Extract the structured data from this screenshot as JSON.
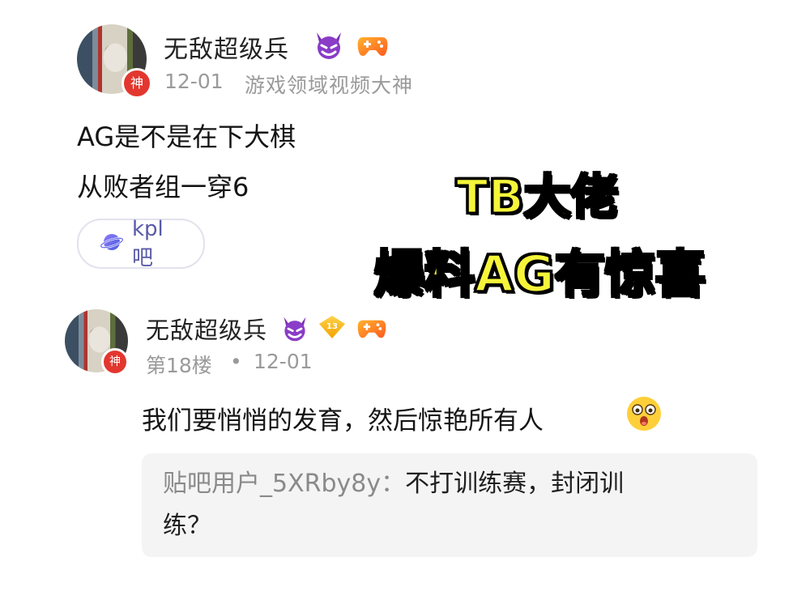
{
  "post": {
    "author": "无敌超级兵",
    "avatar_badge": "神",
    "date": "12-01",
    "title": "游戏领域视频大神",
    "lines": [
      "AG是不是在下大棋",
      "从败者组一穿6"
    ],
    "forum_tag": "kpl吧"
  },
  "overlay": {
    "line1": "TB大佬",
    "line2": "爆料AG有惊喜",
    "color": "#f5f53a"
  },
  "reply": {
    "author": "无敌超级兵",
    "avatar_badge": "神",
    "level": "13",
    "floor": "第18楼",
    "separator": "•",
    "date": "12-01",
    "text": "我们要悄悄的发育，然后惊艳所有人",
    "quote_user": "贴吧用户_5XRby8y：",
    "quote_text_line1": "不打训练赛，封闭训",
    "quote_text_line2": "练？"
  },
  "icons": [
    "devil-icon",
    "gamepad-icon",
    "level-icon",
    "planet-icon",
    "surprised-face-icon"
  ]
}
